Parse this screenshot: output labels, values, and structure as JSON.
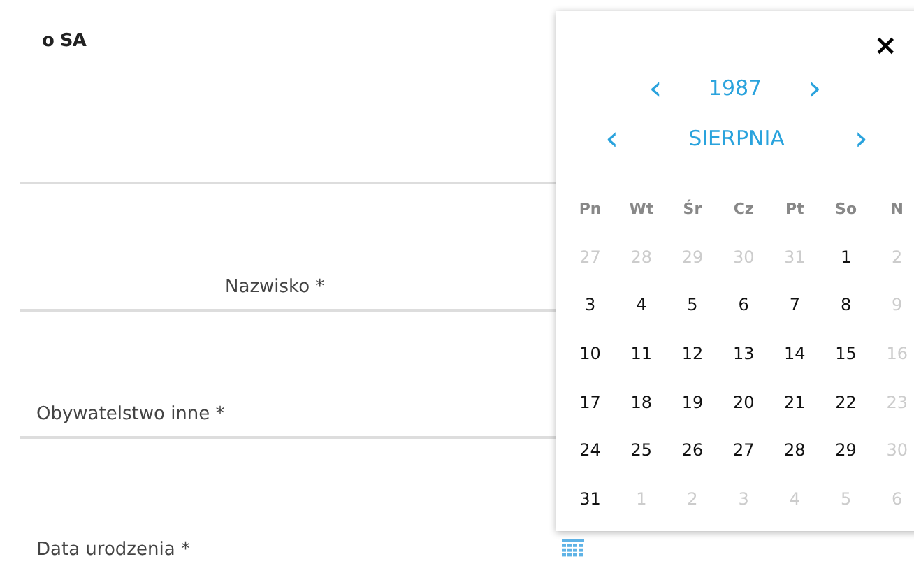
{
  "form": {
    "heading": "o SA",
    "fields": [
      {
        "label": "Nazwisko *",
        "kind": "centered"
      },
      {
        "label": "Obywatelstwo inne *",
        "kind": "plain"
      },
      {
        "label": "Data urodzenia *",
        "kind": "plain",
        "calendar_button": true
      }
    ]
  },
  "datepicker": {
    "close": "×",
    "year": "1987",
    "month": "SIERPNIA",
    "prev": "‹",
    "next": "›",
    "weekdays": [
      "Pn",
      "Wt",
      "Śr",
      "Cz",
      "Pt",
      "So",
      "N"
    ],
    "weeks": [
      [
        {
          "label": "27",
          "disabled": true
        },
        {
          "label": "28",
          "disabled": true
        },
        {
          "label": "29",
          "disabled": true
        },
        {
          "label": "30",
          "disabled": true
        },
        {
          "label": "31",
          "disabled": true
        },
        {
          "label": "1",
          "disabled": false
        },
        {
          "label": "2",
          "disabled": true
        }
      ],
      [
        {
          "label": "3",
          "disabled": false
        },
        {
          "label": "4",
          "disabled": false
        },
        {
          "label": "5",
          "disabled": false
        },
        {
          "label": "6",
          "disabled": false
        },
        {
          "label": "7",
          "disabled": false
        },
        {
          "label": "8",
          "disabled": false
        },
        {
          "label": "9",
          "disabled": true
        }
      ],
      [
        {
          "label": "10",
          "disabled": false
        },
        {
          "label": "11",
          "disabled": false
        },
        {
          "label": "12",
          "disabled": false
        },
        {
          "label": "13",
          "disabled": false
        },
        {
          "label": "14",
          "disabled": false
        },
        {
          "label": "15",
          "disabled": false
        },
        {
          "label": "16",
          "disabled": true
        }
      ],
      [
        {
          "label": "17",
          "disabled": false
        },
        {
          "label": "18",
          "disabled": false
        },
        {
          "label": "19",
          "disabled": false
        },
        {
          "label": "20",
          "disabled": false
        },
        {
          "label": "21",
          "disabled": false
        },
        {
          "label": "22",
          "disabled": false
        },
        {
          "label": "23",
          "disabled": true
        }
      ],
      [
        {
          "label": "24",
          "disabled": false
        },
        {
          "label": "25",
          "disabled": false
        },
        {
          "label": "26",
          "disabled": false
        },
        {
          "label": "27",
          "disabled": false
        },
        {
          "label": "28",
          "disabled": false
        },
        {
          "label": "29",
          "disabled": false
        },
        {
          "label": "30",
          "disabled": true
        }
      ],
      [
        {
          "label": "31",
          "disabled": false
        },
        {
          "label": "1",
          "disabled": true
        },
        {
          "label": "2",
          "disabled": true
        },
        {
          "label": "3",
          "disabled": true
        },
        {
          "label": "4",
          "disabled": true
        },
        {
          "label": "5",
          "disabled": true
        },
        {
          "label": "6",
          "disabled": true
        }
      ]
    ]
  }
}
